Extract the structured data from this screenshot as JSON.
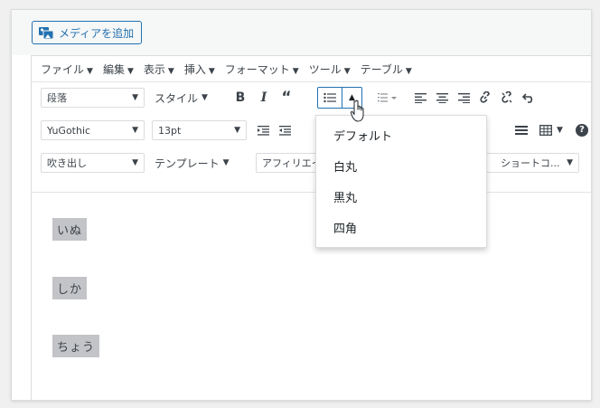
{
  "media": {
    "label": "メディアを追加",
    "icon": "media-icon"
  },
  "menubar": [
    {
      "label": "ファイル"
    },
    {
      "label": "編集"
    },
    {
      "label": "表示"
    },
    {
      "label": "挿入"
    },
    {
      "label": "フォーマット"
    },
    {
      "label": "ツール"
    },
    {
      "label": "テーブル"
    }
  ],
  "toolbar1": {
    "format_select": "段落",
    "style_menu": "スタイル",
    "bold": "B",
    "italic": "I",
    "quote": "“",
    "icons": [
      "bullet-list-icon",
      "numbered-list-icon",
      "align-left-icon",
      "align-center-icon",
      "align-right-icon",
      "link-icon",
      "unlink-icon",
      "undo-icon"
    ]
  },
  "toolbar2": {
    "font_select": "YuGothic",
    "size_select": "13pt",
    "icons": [
      "indent-icon",
      "outdent-icon",
      "horizontal-rule-icon",
      "table-icon",
      "help-icon"
    ]
  },
  "toolbar3": {
    "balloon_select": "吹き出し",
    "template_menu": "テンプレート",
    "affiliate_menu": "アフィリエイト",
    "shortcode_select": "ショートコ..."
  },
  "bullet_dropdown": {
    "items": [
      "デフォルト",
      "白丸",
      "黒丸",
      "四角"
    ]
  },
  "content": {
    "paragraphs": [
      "いぬ",
      "しか",
      "ちょう"
    ]
  },
  "colors": {
    "accent": "#2271b1",
    "highlight": "#c3c4c7"
  }
}
